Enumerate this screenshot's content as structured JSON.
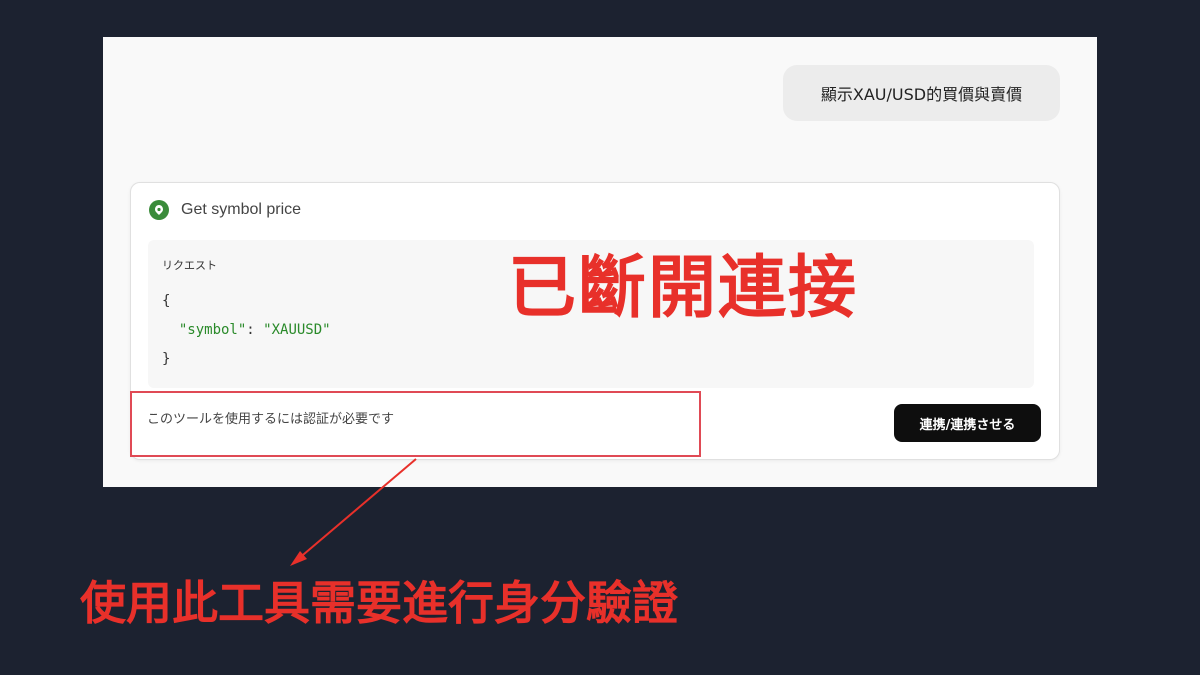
{
  "chat": {
    "user_message": "顯示XAU/USD的買價與賣價"
  },
  "tool_call": {
    "title": "Get symbol price",
    "request_label": "リクエスト",
    "code_open": "{",
    "code_key": "\"symbol\"",
    "code_colon": ": ",
    "code_value": "\"XAUUSD\"",
    "code_close": "}",
    "auth_message": "このツールを使用するには認証が必要です",
    "connect_button": "連携/連携させる"
  },
  "annotations": {
    "disconnected": "已斷開連接",
    "auth_caption": "使用此工具需要進行身分驗證",
    "accent_color": "#e8302a"
  }
}
